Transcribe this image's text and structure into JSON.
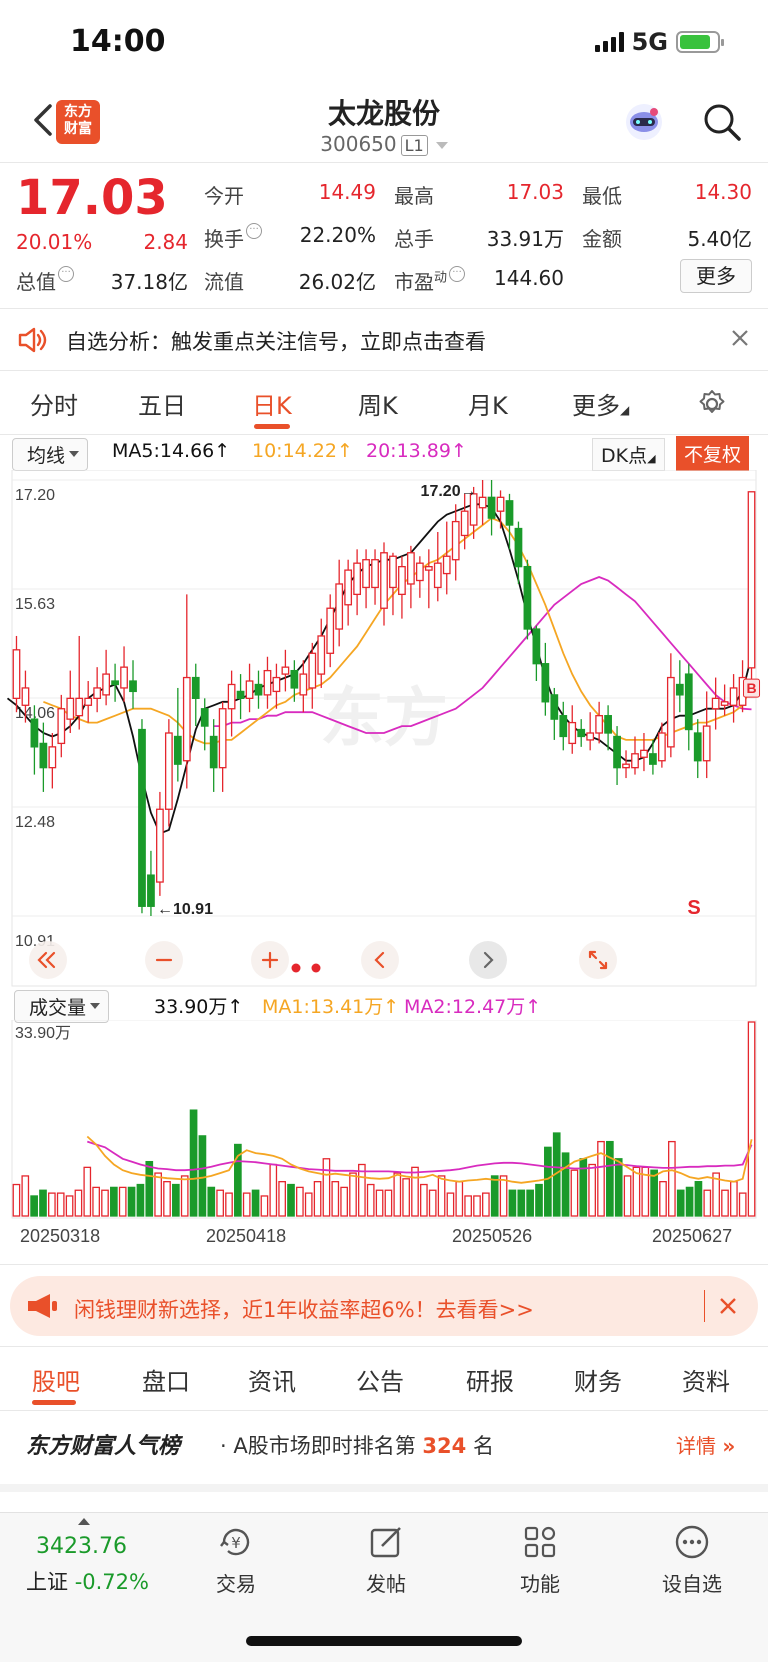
{
  "status_bar": {
    "time": "14:00",
    "network": "5G"
  },
  "header": {
    "logo_line1": "东方",
    "logo_line2": "财富",
    "stock_name": "太龙股份",
    "stock_code": "300650",
    "level": "L1"
  },
  "quote": {
    "price": "17.03",
    "change_pct": "20.01%",
    "change": "2.84",
    "rows": [
      [
        {
          "label": "今开",
          "value": "14.49",
          "color": "red"
        },
        {
          "label": "最高",
          "value": "17.03",
          "color": "red"
        },
        {
          "label": "最低",
          "value": "14.30",
          "color": "red"
        }
      ],
      [
        {
          "label": "换手",
          "value": "22.20%",
          "color": "black"
        },
        {
          "label": "总手",
          "value": "33.91万",
          "color": "black"
        },
        {
          "label": "金额",
          "value": "5.40亿",
          "color": "black"
        }
      ],
      [
        {
          "label": "总值",
          "value": "37.18亿",
          "color": "black"
        },
        {
          "label": "流值",
          "value": "26.02亿",
          "color": "black"
        },
        {
          "label": "市盈",
          "sup": "动",
          "value": "144.60",
          "color": "black"
        }
      ]
    ],
    "more_label": "更多"
  },
  "analysis": {
    "text": "自选分析：触发重点关注信号，立即点击查看"
  },
  "period_tabs": [
    "分时",
    "五日",
    "日K",
    "周K",
    "月K",
    "更多"
  ],
  "active_period": "日K",
  "kline_header": {
    "indicator": "均线",
    "ma5": "MA5:14.66↑",
    "ma10": "10:14.22↑",
    "ma20": "20:13.89↑",
    "dk_label": "DK点",
    "adjust_label": "不复权"
  },
  "kline_axis": {
    "labels": [
      "17.20",
      "15.63",
      "14.06",
      "12.48",
      "10.91"
    ]
  },
  "kline_annotations": {
    "high": "17.20→",
    "low": "←10.91",
    "buy_mark": "B",
    "sell_mark": "S"
  },
  "volume_header": {
    "indicator": "成交量",
    "vol": "33.90万↑",
    "ma1": "MA1:13.41万↑",
    "ma2": "MA2:12.47万↑",
    "axis_top": "33.90万"
  },
  "date_labels": [
    "20250318",
    "20250418",
    "20250526",
    "20250627"
  ],
  "colors": {
    "up": "#e5262d",
    "down": "#1a9a2a",
    "ma5": "#111111",
    "ma10": "#f5a623",
    "ma20": "#d82bbf",
    "accent": "#e9502a"
  },
  "chart_data": {
    "type": "candlestick",
    "ylim": [
      10.91,
      17.2
    ],
    "candles": [
      {
        "o": 14.05,
        "c": 14.75,
        "h": 14.95,
        "l": 13.85
      },
      {
        "o": 13.95,
        "c": 14.2,
        "h": 14.45,
        "l": 13.7
      },
      {
        "o": 13.75,
        "c": 13.35,
        "h": 13.95,
        "l": 12.95
      },
      {
        "o": 13.4,
        "c": 13.05,
        "h": 13.7,
        "l": 12.7
      },
      {
        "o": 13.05,
        "c": 13.35,
        "h": 13.55,
        "l": 12.75
      },
      {
        "o": 13.4,
        "c": 13.9,
        "h": 14.1,
        "l": 13.2
      },
      {
        "o": 13.75,
        "c": 14.05,
        "h": 14.45,
        "l": 13.55
      },
      {
        "o": 13.8,
        "c": 14.05,
        "h": 14.95,
        "l": 13.6
      },
      {
        "o": 13.95,
        "c": 14.05,
        "h": 14.3,
        "l": 13.7
      },
      {
        "o": 14.05,
        "c": 14.2,
        "h": 14.5,
        "l": 13.85
      },
      {
        "o": 14.1,
        "c": 14.4,
        "h": 14.75,
        "l": 13.95
      },
      {
        "o": 14.3,
        "c": 14.25,
        "h": 14.55,
        "l": 14.0
      },
      {
        "o": 14.2,
        "c": 14.5,
        "h": 14.8,
        "l": 14.0
      },
      {
        "o": 14.3,
        "c": 14.15,
        "h": 14.6,
        "l": 13.9
      },
      {
        "o": 13.6,
        "c": 11.05,
        "h": 13.75,
        "l": 10.95
      },
      {
        "o": 11.5,
        "c": 11.05,
        "h": 11.85,
        "l": 10.91
      },
      {
        "o": 11.4,
        "c": 12.45,
        "h": 12.7,
        "l": 11.2
      },
      {
        "o": 12.45,
        "c": 13.55,
        "h": 13.75,
        "l": 12.2
      },
      {
        "o": 13.5,
        "c": 13.1,
        "h": 14.2,
        "l": 12.85
      },
      {
        "o": 13.15,
        "c": 14.35,
        "h": 15.55,
        "l": 12.75
      },
      {
        "o": 14.35,
        "c": 14.05,
        "h": 14.55,
        "l": 13.65
      },
      {
        "o": 13.9,
        "c": 13.65,
        "h": 14.05,
        "l": 13.3
      },
      {
        "o": 13.5,
        "c": 13.05,
        "h": 13.75,
        "l": 12.7
      },
      {
        "o": 13.05,
        "c": 13.9,
        "h": 14.0,
        "l": 12.7
      },
      {
        "o": 13.9,
        "c": 14.25,
        "h": 14.45,
        "l": 13.5
      },
      {
        "o": 14.15,
        "c": 14.05,
        "h": 14.4,
        "l": 13.75
      },
      {
        "o": 14.05,
        "c": 14.3,
        "h": 14.55,
        "l": 13.85
      },
      {
        "o": 14.25,
        "c": 14.1,
        "h": 14.45,
        "l": 13.9
      },
      {
        "o": 14.1,
        "c": 14.45,
        "h": 14.65,
        "l": 13.9
      },
      {
        "o": 14.15,
        "c": 14.35,
        "h": 14.55,
        "l": 13.9
      },
      {
        "o": 14.4,
        "c": 14.5,
        "h": 14.75,
        "l": 14.15
      },
      {
        "o": 14.45,
        "c": 14.2,
        "h": 14.6,
        "l": 14.0
      },
      {
        "o": 14.1,
        "c": 14.4,
        "h": 14.6,
        "l": 13.85
      },
      {
        "o": 14.2,
        "c": 14.7,
        "h": 14.85,
        "l": 13.9
      },
      {
        "o": 14.4,
        "c": 14.95,
        "h": 15.2,
        "l": 14.2
      },
      {
        "o": 14.7,
        "c": 15.35,
        "h": 15.55,
        "l": 14.5
      },
      {
        "o": 15.05,
        "c": 15.7,
        "h": 16.05,
        "l": 14.8
      },
      {
        "o": 15.4,
        "c": 15.9,
        "h": 16.05,
        "l": 15.1
      },
      {
        "o": 15.55,
        "c": 16.0,
        "h": 16.2,
        "l": 15.25
      },
      {
        "o": 15.65,
        "c": 16.05,
        "h": 16.2,
        "l": 15.35
      },
      {
        "o": 15.65,
        "c": 16.05,
        "h": 16.2,
        "l": 15.4
      },
      {
        "o": 15.35,
        "c": 16.15,
        "h": 16.3,
        "l": 15.1
      },
      {
        "o": 15.65,
        "c": 16.1,
        "h": 16.15,
        "l": 15.25
      },
      {
        "o": 15.55,
        "c": 15.95,
        "h": 16.1,
        "l": 15.2
      },
      {
        "o": 15.7,
        "c": 16.15,
        "h": 16.25,
        "l": 15.35
      },
      {
        "o": 15.75,
        "c": 16.0,
        "h": 16.1,
        "l": 15.5
      },
      {
        "o": 15.9,
        "c": 15.95,
        "h": 16.2,
        "l": 15.35
      },
      {
        "o": 15.65,
        "c": 16.0,
        "h": 16.45,
        "l": 15.45
      },
      {
        "o": 15.85,
        "c": 16.1,
        "h": 16.6,
        "l": 15.55
      },
      {
        "o": 16.05,
        "c": 16.6,
        "h": 16.85,
        "l": 15.75
      },
      {
        "o": 16.4,
        "c": 16.75,
        "h": 17.0,
        "l": 16.2
      },
      {
        "o": 16.55,
        "c": 17.0,
        "h": 17.1,
        "l": 16.35
      },
      {
        "o": 16.8,
        "c": 16.95,
        "h": 17.2,
        "l": 16.55
      },
      {
        "o": 16.95,
        "c": 16.65,
        "h": 17.2,
        "l": 16.4
      },
      {
        "o": 16.75,
        "c": 16.95,
        "h": 17.05,
        "l": 16.5
      },
      {
        "o": 16.9,
        "c": 16.55,
        "h": 17.0,
        "l": 16.2
      },
      {
        "o": 16.5,
        "c": 15.95,
        "h": 16.6,
        "l": 15.7
      },
      {
        "o": 15.95,
        "c": 15.05,
        "h": 16.05,
        "l": 14.9
      },
      {
        "o": 15.05,
        "c": 14.55,
        "h": 15.1,
        "l": 14.3
      },
      {
        "o": 14.55,
        "c": 14.0,
        "h": 14.85,
        "l": 13.8
      },
      {
        "o": 14.1,
        "c": 13.75,
        "h": 14.2,
        "l": 13.45
      },
      {
        "o": 13.8,
        "c": 13.5,
        "h": 14.0,
        "l": 13.3
      },
      {
        "o": 13.4,
        "c": 13.7,
        "h": 13.95,
        "l": 13.25
      },
      {
        "o": 13.6,
        "c": 13.5,
        "h": 13.75,
        "l": 13.35
      },
      {
        "o": 13.45,
        "c": 13.55,
        "h": 13.85,
        "l": 13.3
      },
      {
        "o": 13.55,
        "c": 13.8,
        "h": 14.0,
        "l": 13.4
      },
      {
        "o": 13.8,
        "c": 13.55,
        "h": 13.95,
        "l": 13.3
      },
      {
        "o": 13.5,
        "c": 13.05,
        "h": 13.65,
        "l": 12.8
      },
      {
        "o": 13.05,
        "c": 13.1,
        "h": 13.3,
        "l": 12.9
      },
      {
        "o": 13.05,
        "c": 13.25,
        "h": 13.5,
        "l": 12.95
      },
      {
        "o": 13.2,
        "c": 13.3,
        "h": 13.55,
        "l": 13.0
      },
      {
        "o": 13.25,
        "c": 13.1,
        "h": 13.45,
        "l": 12.95
      },
      {
        "o": 13.15,
        "c": 13.55,
        "h": 13.7,
        "l": 13.05
      },
      {
        "o": 13.35,
        "c": 14.35,
        "h": 14.7,
        "l": 13.2
      },
      {
        "o": 14.25,
        "c": 14.1,
        "h": 14.6,
        "l": 13.85
      },
      {
        "o": 14.4,
        "c": 13.6,
        "h": 14.55,
        "l": 13.3
      },
      {
        "o": 13.55,
        "c": 13.15,
        "h": 13.75,
        "l": 12.9
      },
      {
        "o": 13.15,
        "c": 13.65,
        "h": 14.15,
        "l": 12.9
      },
      {
        "o": 13.9,
        "c": 14.05,
        "h": 14.35,
        "l": 13.6
      },
      {
        "o": 13.95,
        "c": 14.0,
        "h": 14.25,
        "l": 13.8
      },
      {
        "o": 13.95,
        "c": 14.2,
        "h": 14.4,
        "l": 13.7
      },
      {
        "o": 13.95,
        "c": 14.35,
        "h": 14.6,
        "l": 13.85
      },
      {
        "o": 14.49,
        "c": 17.03,
        "h": 17.03,
        "l": 14.3
      }
    ],
    "ma5": [
      14.05,
      13.95,
      13.8,
      13.65,
      13.55,
      13.5,
      13.55,
      13.65,
      13.8,
      14.05,
      14.15,
      14.2,
      14.25,
      14.0,
      13.5,
      12.9,
      12.4,
      12.1,
      12.15,
      12.6,
      13.1,
      13.6,
      13.9,
      13.95,
      14.0,
      14.0,
      14.05,
      14.1,
      14.2,
      14.25,
      14.3,
      14.35,
      14.4,
      14.55,
      14.75,
      14.95,
      15.2,
      15.45,
      15.7,
      15.85,
      15.95,
      16.0,
      16.05,
      16.05,
      16.1,
      16.15,
      16.3,
      16.45,
      16.6,
      16.7,
      16.75,
      16.8,
      16.85,
      16.85,
      16.8,
      16.6,
      16.2,
      15.75,
      15.25,
      14.8,
      14.35,
      14.0,
      13.8,
      13.65,
      13.55,
      13.5,
      13.45,
      13.35,
      13.25,
      13.15,
      13.15,
      13.2,
      13.4,
      13.65,
      13.75,
      13.8,
      13.8,
      13.85,
      13.9,
      13.9,
      13.9,
      13.95,
      14.15,
      14.66
    ],
    "ma10": [
      14.0,
      13.95,
      13.9,
      13.8,
      13.75,
      13.7,
      13.7,
      13.75,
      13.8,
      13.85,
      13.9,
      13.9,
      13.9,
      13.85,
      13.8,
      13.7,
      13.55,
      13.45,
      13.4,
      13.4,
      13.45,
      13.45,
      13.55,
      13.65,
      13.75,
      13.85,
      13.95,
      14.0,
      14.1,
      14.15,
      14.2,
      14.25,
      14.35,
      14.5,
      14.65,
      14.8,
      15.0,
      15.2,
      15.4,
      15.55,
      15.7,
      15.8,
      15.9,
      16.0,
      16.05,
      16.15,
      16.25,
      16.35,
      16.45,
      16.55,
      16.65,
      16.6,
      16.45,
      16.25,
      16.0,
      15.7,
      15.4,
      15.05,
      14.7,
      14.4,
      14.15,
      13.95,
      13.8,
      13.65,
      13.5,
      13.45,
      13.45,
      13.45,
      13.45,
      13.5,
      13.55,
      13.6,
      13.65,
      13.7,
      13.7,
      13.75,
      13.8,
      13.85,
      13.95,
      14.22
    ],
    "ma20": [
      13.65,
      13.65,
      13.7,
      13.7,
      13.75,
      13.75,
      13.8,
      13.8,
      13.85,
      13.85,
      13.85,
      13.85,
      13.8,
      13.75,
      13.7,
      13.65,
      13.6,
      13.55,
      13.55,
      13.55,
      13.6,
      13.65,
      13.65,
      13.7,
      13.75,
      13.8,
      13.85,
      13.9,
      14.0,
      14.1,
      14.2,
      14.35,
      14.5,
      14.65,
      14.8,
      14.95,
      15.1,
      15.25,
      15.4,
      15.5,
      15.6,
      15.7,
      15.75,
      15.8,
      15.75,
      15.65,
      15.55,
      15.45,
      15.3,
      15.15,
      15.0,
      14.85,
      14.7,
      14.55,
      14.4,
      14.25,
      14.1,
      14.0,
      13.95,
      13.9,
      13.89
    ],
    "volume": {
      "max": 33.9,
      "values": [
        5.5,
        7.0,
        3.5,
        4.5,
        4.0,
        4.0,
        3.5,
        4.5,
        8.5,
        5.0,
        4.5,
        5.0,
        5.0,
        5.0,
        5.5,
        9.5,
        7.5,
        6.0,
        5.5,
        7.0,
        18.5,
        14.0,
        5.0,
        4.5,
        4.0,
        12.5,
        4.0,
        4.5,
        3.5,
        9.0,
        6.0,
        5.5,
        5.0,
        4.0,
        6.0,
        10.0,
        6.0,
        5.0,
        7.5,
        9.0,
        5.5,
        4.5,
        4.5,
        7.5,
        6.5,
        8.5,
        5.5,
        4.5,
        7.0,
        4.0,
        6.0,
        3.5,
        3.5,
        4.0,
        7.0,
        7.0,
        4.5,
        4.5,
        4.5,
        5.5,
        12.0,
        14.5,
        11.0,
        8.0,
        10.0,
        9.0,
        13.0,
        13.0,
        10.0,
        7.0,
        8.5,
        8.5,
        8.0,
        6.0,
        13.0,
        4.5,
        5.0,
        6.0,
        4.5,
        7.5,
        4.5,
        6.0,
        4.0,
        33.9
      ],
      "ma1": [
        13.9,
        12.5,
        10.5,
        9.0,
        8.0,
        7.5,
        7.2,
        7.0,
        6.8,
        6.6,
        6.5,
        6.4,
        6.5,
        6.7,
        7.0,
        7.5,
        8.0,
        10.5,
        11.5,
        11.0,
        10.8,
        10.5,
        10.0,
        9.0,
        8.3,
        7.8,
        7.5,
        7.2,
        7.4,
        7.2,
        7.0,
        6.8,
        6.6,
        6.5,
        6.6,
        7.2,
        6.9,
        6.7,
        6.8,
        7.2,
        6.5,
        6.2,
        6.0,
        6.2,
        6.3,
        6.5,
        6.3,
        6.3,
        6.0,
        5.8,
        6.0,
        6.2,
        6.5,
        7.5,
        8.5,
        9.5,
        10.0,
        10.5,
        11.0,
        10.2,
        9.5,
        8.5,
        7.5,
        7.2,
        7.0,
        7.8,
        8.0,
        7.5,
        6.8,
        6.5,
        6.8,
        6.5,
        6.2,
        6.0,
        6.5,
        13.41
      ],
      "ma2": [
        13.0,
        12.5,
        12.0,
        11.0,
        10.0,
        9.5,
        9.0,
        8.6,
        8.3,
        8.2,
        8.0,
        8.0,
        8.1,
        8.3,
        8.6,
        9.0,
        9.3,
        9.6,
        9.5,
        9.4,
        9.2,
        9.0,
        8.8,
        8.6,
        8.4,
        8.2,
        8.1,
        8.0,
        7.9,
        7.9,
        7.9,
        7.8,
        7.8,
        7.8,
        7.8,
        7.7,
        7.6,
        7.6,
        7.7,
        7.8,
        7.9,
        8.0,
        8.2,
        8.5,
        8.8,
        9.0,
        9.2,
        9.3,
        9.3,
        9.2,
        9.0,
        8.8,
        8.6,
        8.5,
        8.4,
        8.3,
        8.3,
        8.4,
        8.6,
        8.8,
        9.0,
        8.9,
        8.7,
        8.6,
        8.5,
        8.4,
        8.4,
        8.5,
        8.6,
        8.6,
        8.7,
        8.7,
        8.8,
        8.8,
        9.0,
        12.47
      ]
    }
  },
  "content_tabs": [
    "股吧",
    "盘口",
    "资讯",
    "公告",
    "研报",
    "财务",
    "资料"
  ],
  "active_content_tab": "股吧",
  "promo": {
    "text": "闲钱理财新选择，近1年收益率超6%！去看看>>"
  },
  "popularity": {
    "brand": "东方财富人气榜",
    "prefix": "· A股市场即时排名第",
    "rank": "324",
    "suffix": "名",
    "detail": "详情"
  },
  "bottom_nav": {
    "index_value": "3423.76",
    "index_name": "上证",
    "index_change": "-0.72%",
    "items": [
      {
        "label": "交易",
        "icon": "trade-icon"
      },
      {
        "label": "发帖",
        "icon": "edit-icon"
      },
      {
        "label": "功能",
        "icon": "grid-icon"
      },
      {
        "label": "设自选",
        "icon": "more-icon"
      }
    ]
  }
}
